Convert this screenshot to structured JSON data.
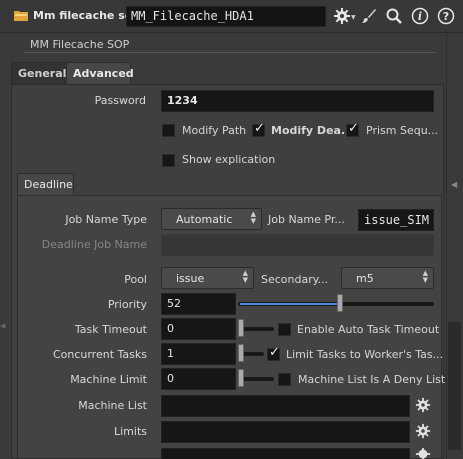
{
  "header": {
    "node_type": "Mm filecache sop",
    "node_name": "MM_Filecache_HDA1",
    "icons": [
      "gear-icon",
      "brush-icon",
      "search-icon",
      "info-icon",
      "help-icon"
    ],
    "info_glyph": "i",
    "help_glyph": "?"
  },
  "sop_label": "MM Filecache SOP",
  "tabs": [
    {
      "label": "General"
    },
    {
      "label": "Advanced"
    }
  ],
  "password": {
    "label": "Password",
    "value": "1234"
  },
  "toggles_row1": [
    {
      "label": "Modify Path",
      "checked": false
    },
    {
      "label": "Modify Dea...",
      "checked": true
    },
    {
      "label": "Prism Sequ...",
      "checked": true
    }
  ],
  "show_explication": {
    "label": "Show explication",
    "checked": false
  },
  "subtab": {
    "label": "Deadline"
  },
  "deadline": {
    "job_name_type": {
      "label": "Job Name Type",
      "value": "Automatic"
    },
    "job_name_prefix": {
      "label": "Job Name Pr...",
      "value": "issue_SIM"
    },
    "deadline_job_name": {
      "label": "Deadline Job Name",
      "value": ""
    },
    "pool": {
      "label": "Pool",
      "value": "issue"
    },
    "secondary_pool": {
      "label": "Secondary...",
      "value": "m5"
    },
    "priority": {
      "label": "Priority",
      "value": "52",
      "slider_fraction": 0.52
    },
    "task_timeout": {
      "label": "Task Timeout",
      "value": "0",
      "toggle_label": "Enable Auto Task Timeout",
      "checked": false
    },
    "concurrent_tasks": {
      "label": "Concurrent Tasks",
      "value": "1",
      "toggle_label": "Limit Tasks to Worker's Tas...",
      "checked": true
    },
    "machine_limit": {
      "label": "Machine Limit",
      "value": "0",
      "toggle_label": "Machine List Is A Deny List",
      "checked": false
    },
    "machine_list": {
      "label": "Machine List",
      "value": ""
    },
    "limits": {
      "label": "Limits",
      "value": ""
    }
  },
  "colors": {
    "slider_fill": "#4f87d8",
    "field_bg": "#161616",
    "panel_bg": "#3a3a3a"
  }
}
